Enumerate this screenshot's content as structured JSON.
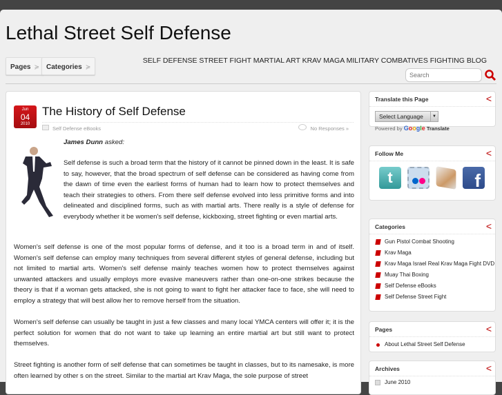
{
  "header": {
    "site_title": "Lethal Street Self Defense",
    "tagline": "SELF DEFENSE STREET FIGHT MARTIAL ART KRAV MAGA MILITARY COMBATIVES FIGHTING BLOG",
    "nav": [
      {
        "label": "Pages"
      },
      {
        "label": "Categories"
      }
    ],
    "search_placeholder": "Search"
  },
  "post": {
    "date": {
      "month": "Jun",
      "day": "04",
      "year": "2010"
    },
    "title": "The History of Self Defense",
    "category": "Self Defense eBooks",
    "responses": "No Responses »",
    "author": "James Dunn",
    "asked": "asked:",
    "paragraphs": [
      "Self defense is such a broad term that the history of it cannot be pinned down in the least. It is safe to say, however, that the broad spectrum of self defense can be considered as having come from the dawn of time even the earliest forms of human had to learn how to protect themselves and teach their strategies to others. From there self defense evolved into less primitive forms and into delineated and disciplined forms, such as with martial arts. There really is a style of defense for everybody whether it be women's self defense, kickboxing, street fighting or even martial arts.",
      "Women's self defense is one of the most popular forms of defense, and it too is a broad term in and of itself. Women's self defense can employ many techniques from several different styles of general defense, including but not limited to martial arts. Women's self defense mainly teaches women how to protect themselves against unwanted attackers and usually employs more evasive maneuvers rather than one-on-one strikes because the theory is that if a woman gets attacked, she is not going to want to fight her attacker face to face, she will need to employ a strategy that will best allow her to remove herself from the situation.",
      "Women's self defense can usually be taught in just a few classes and many local YMCA centers will offer it; it is the perfect solution for women that do not want to take up learning an entire martial art but still want to protect themselves.",
      "Street fighting is another form of self defense that can sometimes be taught in classes, but to its namesake, is more often learned by other s on the street. Similar to the martial art Krav Maga, the sole purpose of street"
    ]
  },
  "sidebar": {
    "translate": {
      "title": "Translate this Page",
      "select": "Select Language",
      "powered_by": "Powered by",
      "google": [
        "G",
        "o",
        "o",
        "g",
        "l",
        "e"
      ],
      "translate": "Translate"
    },
    "follow": {
      "title": "Follow Me",
      "icons": [
        "twitter-icon",
        "flickr-icon",
        "rss-icon",
        "facebook-icon"
      ]
    },
    "categories": {
      "title": "Categories",
      "items": [
        "Gun Pistol Combat Shooting",
        "Krav Maga",
        "Krav Maga Israel Real Krav Maga Fight DVD",
        "Muay Thai Boxing",
        "Self Defense eBooks",
        "Self Defense Street Fight"
      ]
    },
    "pages": {
      "title": "Pages",
      "items": [
        "About Lethal Street Self Defense"
      ]
    },
    "archives": {
      "title": "Archives",
      "items": [
        "June 2010"
      ]
    }
  },
  "colors": {
    "accent": "#c00000",
    "top_bar": "#444444",
    "background": "#efefef"
  }
}
